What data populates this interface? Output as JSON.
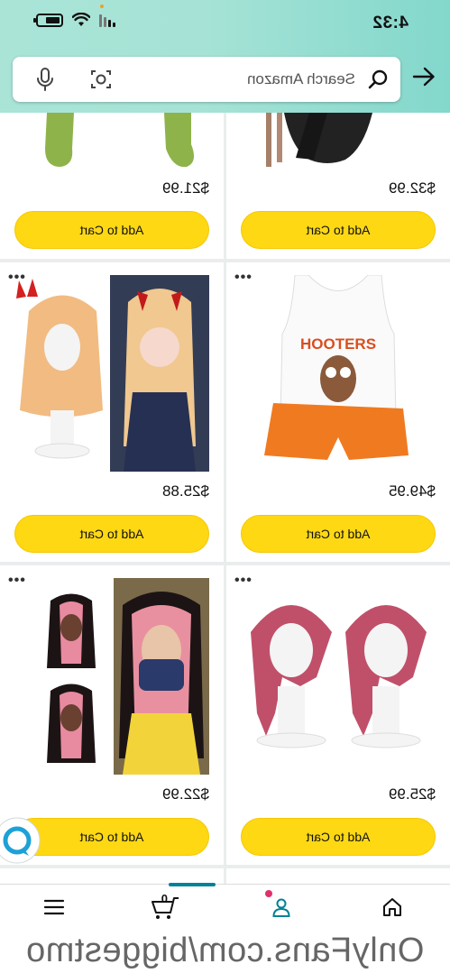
{
  "status_bar": {
    "time": "4:32"
  },
  "search": {
    "placeholder": "Search Amazon"
  },
  "products": [
    {
      "price": "$32.99",
      "button": "Add to Cart"
    },
    {
      "price": "$21.99",
      "button": "Add to Cart"
    },
    {
      "price": "$49.95",
      "button": "Add to Cart",
      "print": "HOOTERS"
    },
    {
      "price": "$25.88",
      "button": "Add to Cart"
    },
    {
      "price": "$25.99",
      "button": "Add to Cart"
    },
    {
      "price": "$22.99",
      "button": "Add to Cart"
    }
  ],
  "more_options": "•••",
  "bottom_nav": {
    "cart_count": "0"
  },
  "watermark": "OnlyFans.com/biggestmo",
  "colors": {
    "button": "#ffd814",
    "accent": "#008296",
    "header": "#a6e3d6"
  }
}
